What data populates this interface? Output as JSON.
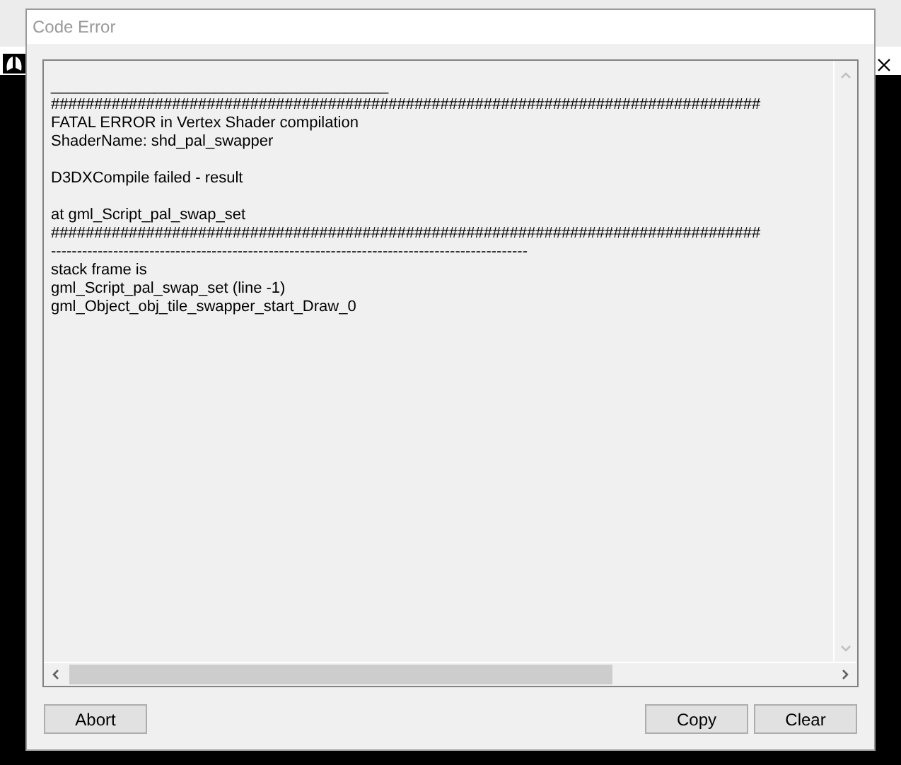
{
  "window": {
    "title": "Code Error"
  },
  "log": {
    "lines": [
      {
        "kind": "text",
        "text": "_______________________________________"
      },
      {
        "kind": "text",
        "text": "##################################################################################"
      },
      {
        "kind": "text",
        "text": "FATAL ERROR in Vertex Shader compilation"
      },
      {
        "kind": "text",
        "text": "ShaderName: shd_pal_swapper"
      },
      {
        "kind": "blank"
      },
      {
        "kind": "text",
        "text": "D3DXCompile failed - result"
      },
      {
        "kind": "blank"
      },
      {
        "kind": "text",
        "text": "at gml_Script_pal_swap_set"
      },
      {
        "kind": "text",
        "text": "##################################################################################"
      },
      {
        "kind": "text",
        "text": "--------------------------------------------------------------------------------------------"
      },
      {
        "kind": "text",
        "text": "stack frame is"
      },
      {
        "kind": "text",
        "text": "gml_Script_pal_swap_set (line -1)"
      },
      {
        "kind": "text",
        "text": "gml_Object_obj_tile_swapper_start_Draw_0"
      }
    ]
  },
  "left_buttons": [
    "Abort"
  ],
  "right_buttons": [
    "Copy",
    "Clear"
  ]
}
